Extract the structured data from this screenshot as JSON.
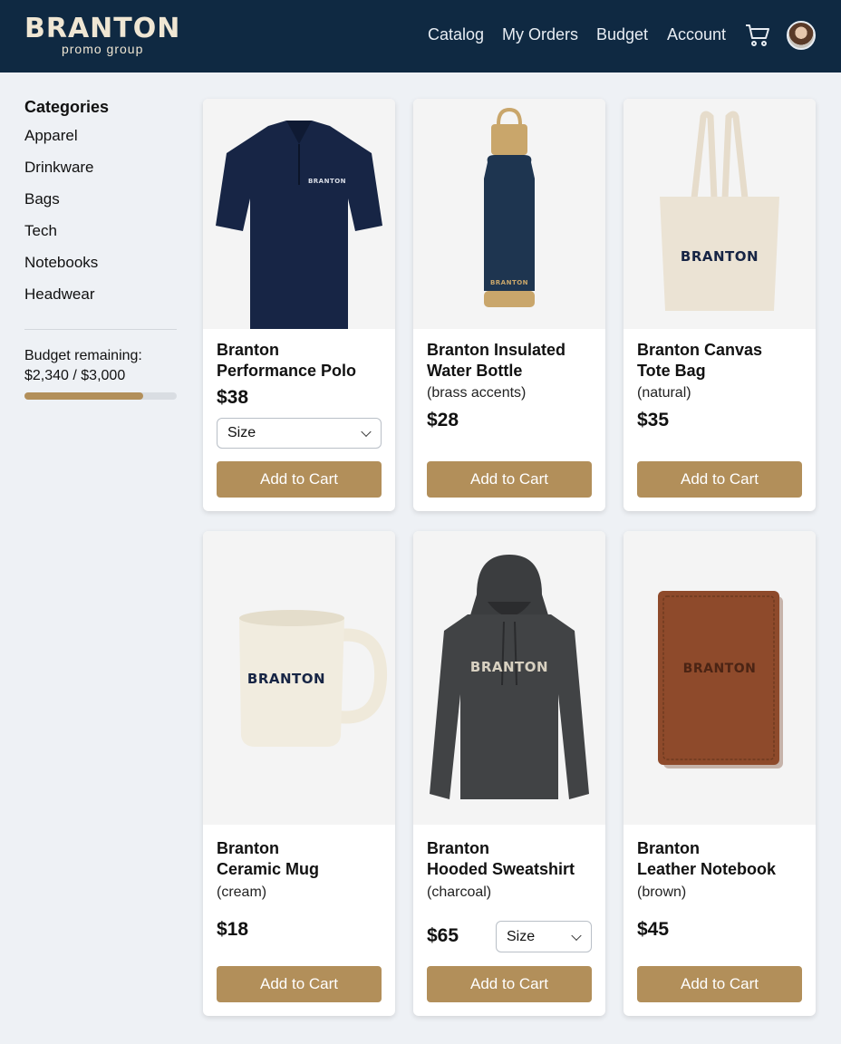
{
  "header": {
    "brand_name": "BRANTON",
    "brand_sub": "promo group",
    "nav": [
      "Catalog",
      "My Orders",
      "Budget",
      "Account"
    ],
    "cart_icon": "cart-icon",
    "avatar": "avatar"
  },
  "sidebar": {
    "title": "Categories",
    "categories": [
      "Apparel",
      "Drinkware",
      "Bags",
      "Tech",
      "Notebooks",
      "Headwear"
    ],
    "budget_label": "Budget remaining:",
    "budget_value": "$2,340 / $3,000",
    "budget_progress": 0.78,
    "budget_color": "#b28f5a"
  },
  "products": [
    {
      "title_line1": "Branton",
      "title_line2": "Performance Polo",
      "variant": "",
      "price": "$38",
      "size_label": "Size",
      "button": "Add to Cart",
      "print": "BRANTON"
    },
    {
      "title_line1": "Branton Insulated",
      "title_line2": "Water Bottle",
      "variant": "(brass accents)",
      "price": "$28",
      "button": "Add to Cart",
      "print": "BRANTON"
    },
    {
      "title_line1": "Branton Canvas",
      "title_line2": "Tote Bag",
      "variant": "(natural)",
      "price": "$35",
      "button": "Add to Cart",
      "print": "BRANTON"
    },
    {
      "title_line1": "Branton",
      "title_line2": "Ceramic Mug",
      "variant": "(cream)",
      "price": "$18",
      "button": "Add to Cart",
      "print": "BRANTON"
    },
    {
      "title_line1": "Branton",
      "title_line2": "Hooded Sweatshirt",
      "variant": "(charcoal)",
      "price": "$65",
      "size_label": "Size",
      "button": "Add to Cart",
      "print": "BRANTON"
    },
    {
      "title_line1": "Branton",
      "title_line2": "Leather Notebook",
      "variant": "(brown)",
      "price": "$45",
      "button": "Add to Cart",
      "print": "BRANTON"
    }
  ],
  "colors": {
    "header_bg": "#0f2942",
    "accent": "#b28f5a",
    "page_bg": "#eef1f5"
  }
}
